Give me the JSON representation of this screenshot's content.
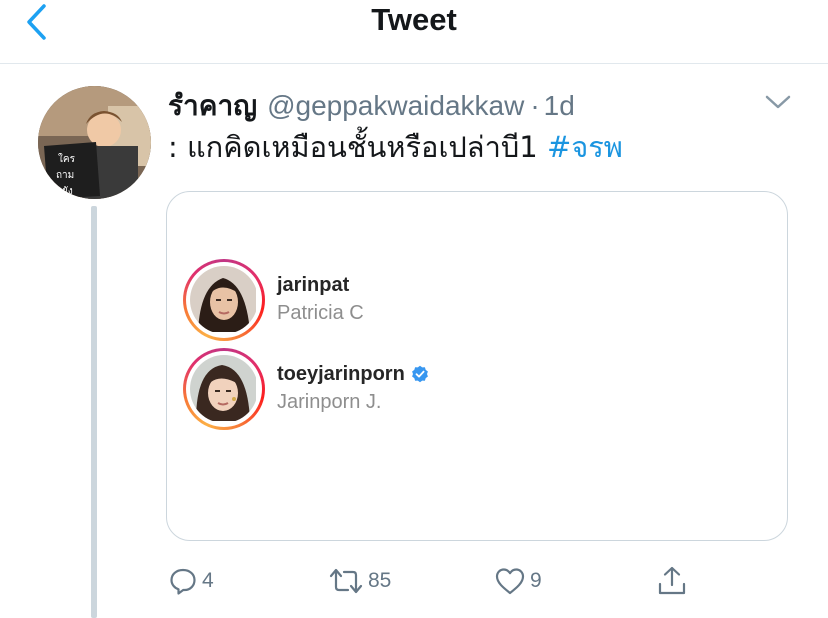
{
  "header": {
    "title": "Tweet",
    "back_icon": "chevron-left-icon"
  },
  "tweet": {
    "display_name": "รำคาญ",
    "username": "@geppakwaidakkaw",
    "separator": "·",
    "time": "1d",
    "text_prefix": ": แกคิดเหมือนชั้นหรือเปล่าบี1 ",
    "hashtag": "#จรพ",
    "avatar_sign_text": "ใคร ถาม ยัง"
  },
  "embedded_image": {
    "accounts": [
      {
        "username": "jarinpat",
        "full_name": "Patricia C",
        "verified": false
      },
      {
        "username": "toeyjarinporn",
        "full_name": "Jarinporn J.",
        "verified": true
      }
    ]
  },
  "actions": {
    "reply_count": "4",
    "retweet_count": "85",
    "like_count": "9",
    "share_label": ""
  },
  "colors": {
    "accent": "#1da1f2",
    "hashtag": "#1b95e0",
    "muted": "#657786",
    "border": "#ccd6dd",
    "verified": "#3897f0"
  }
}
